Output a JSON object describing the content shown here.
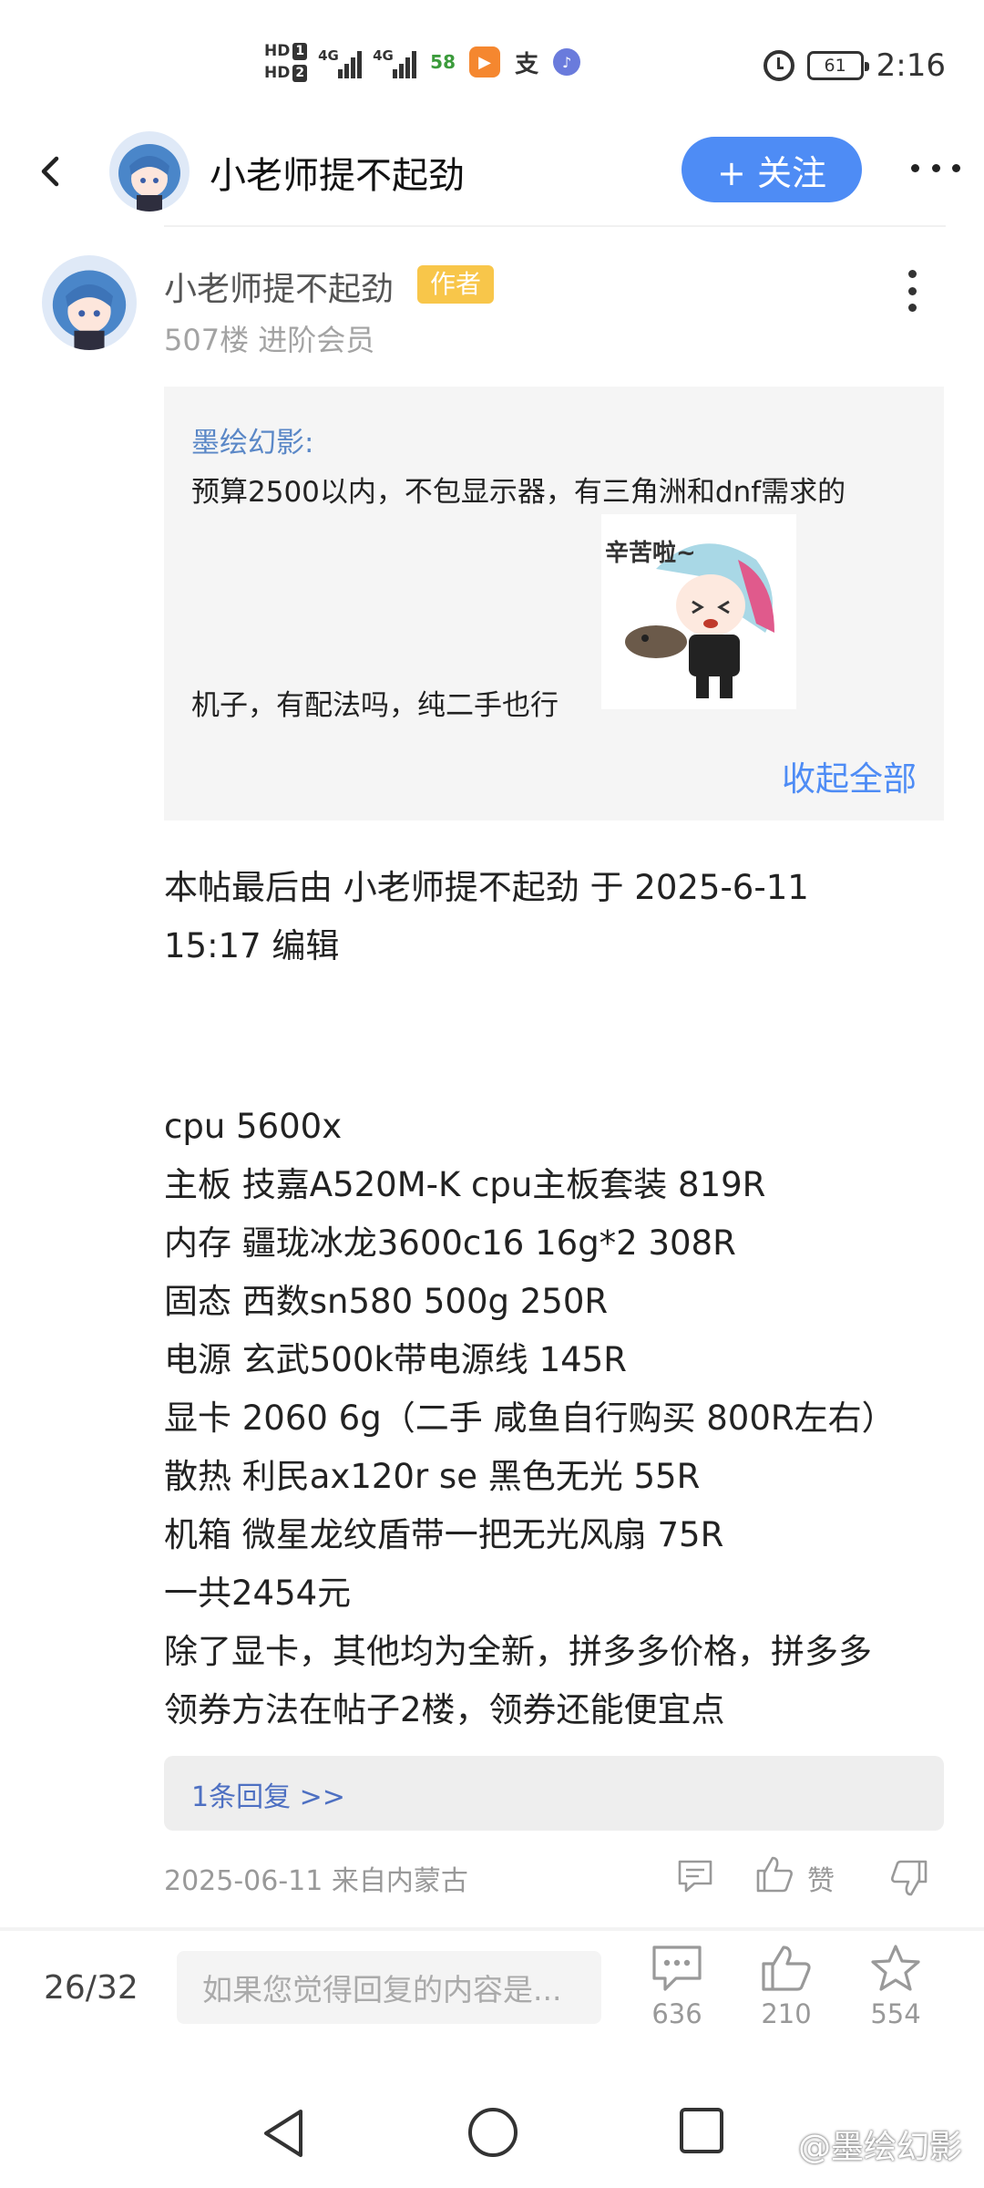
{
  "status_bar": {
    "hd1": "HD",
    "hd1_num": "1",
    "hd2": "HD",
    "hd2_num": "2",
    "net1": "4G",
    "net2": "4G",
    "app_58": "58",
    "app_zhi": "支",
    "battery": "61",
    "time": "2:16"
  },
  "header": {
    "title": "小老师提不起劲",
    "follow_label": "+ 关注"
  },
  "post": {
    "author": "小老师提不起劲",
    "badge": "作者",
    "meta": "507楼 进阶会员",
    "quote": {
      "author": "墨绘幻影:",
      "line1": "预算2500以内，不包显示器，有三角洲和dnf需求的",
      "line2": "机子，有配法吗，纯二手也行",
      "sticker_caption": "辛苦啦~",
      "collapse": "收起全部"
    },
    "edit_note_1": "本帖最后由 小老师提不起劲 于 2025-6-11",
    "edit_note_2": "15:17 编辑",
    "lines": [
      "cpu 5600x",
      "主板 技嘉A520M-K  cpu主板套装 819R",
      "内存 疆珑冰龙3600c16  16g*2 308R",
      "固态 西数sn580 500g 250R",
      "电源 玄武500k带电源线 145R",
      "显卡 2060 6g（二手 咸鱼自行购买 800R左右）",
      "散热 利民ax120r se 黑色无光 55R",
      "机箱 微星龙纹盾带一把无光风扇 75R",
      "一共2454元",
      "除了显卡，其他均为全新，拼多多价格，拼多多",
      "领券方法在帖子2楼，领券还能便宜点"
    ],
    "reply_link": "1条回复 >>",
    "time_location": "2025-06-11 来自内蒙古",
    "like_label": "赞"
  },
  "bottom_bar": {
    "page": "26/32",
    "input_placeholder": "如果您觉得回复的内容是...",
    "comments": "636",
    "likes": "210",
    "favorites": "554"
  },
  "watermark": "@墨绘幻影",
  "colors": {
    "accent": "#4e8cf5",
    "badge": "#f8c64a",
    "quote_bg": "#f5f5f5",
    "quote_author": "#5b88c7"
  }
}
